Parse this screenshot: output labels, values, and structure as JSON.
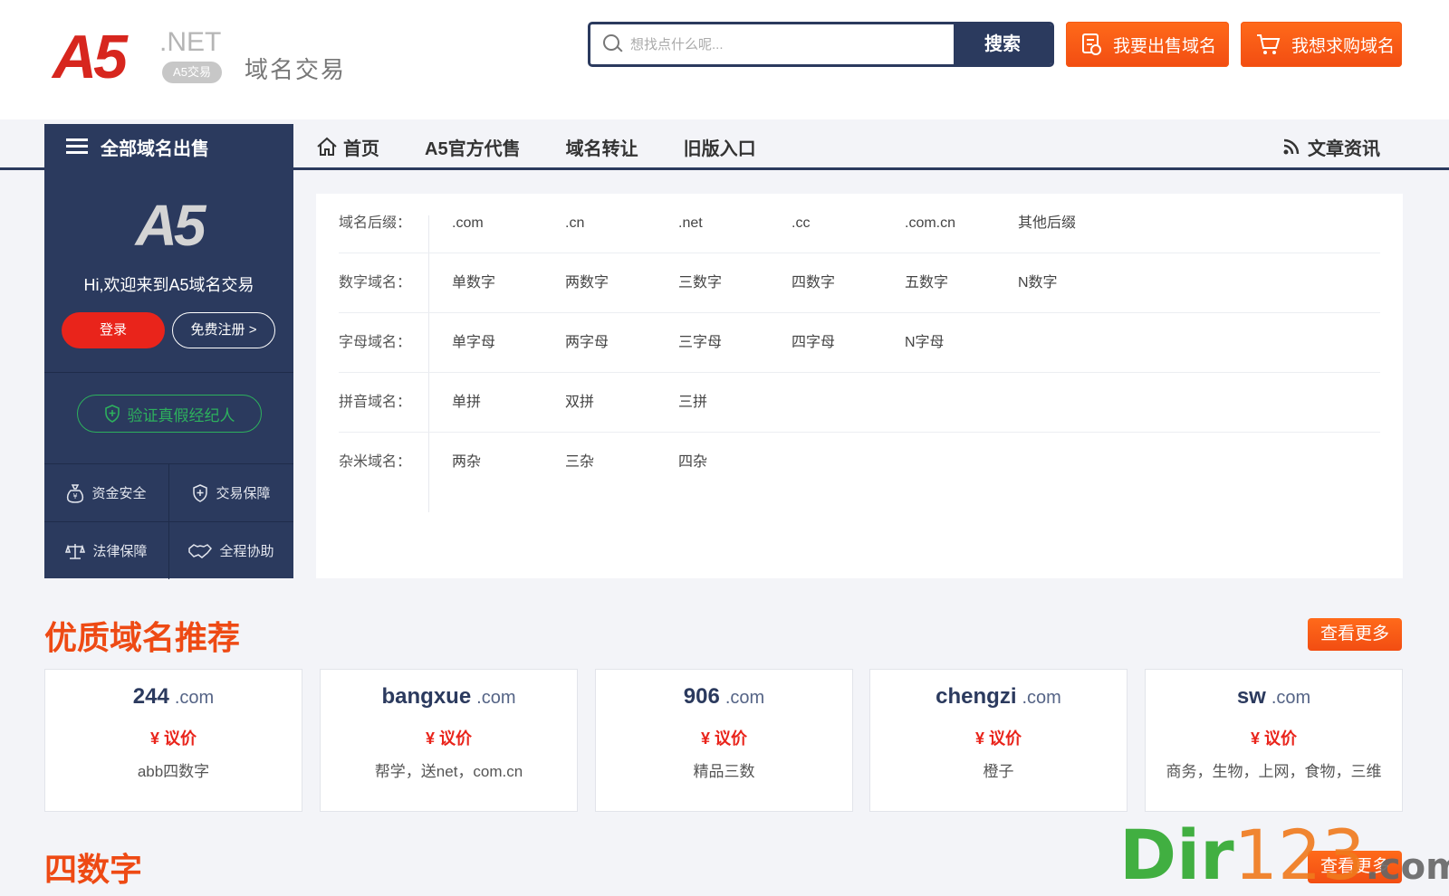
{
  "header": {
    "logo_main": "A5",
    "logo_net": ".NET",
    "logo_badge": "A5交易",
    "logo_subtitle": "域名交易",
    "search_placeholder": "想找点什么呢...",
    "search_button": "搜索",
    "sell_button": "我要出售域名",
    "buy_button": "我想求购域名",
    "accent_color": "#f55a16",
    "navy_color": "#2b3a5e"
  },
  "nav": {
    "category_label": "全部域名出售",
    "items": [
      {
        "label": "首页",
        "icon": "home-icon"
      },
      {
        "label": "A5官方代售"
      },
      {
        "label": "域名转让"
      },
      {
        "label": "旧版入口"
      }
    ],
    "articles_label": "文章资讯",
    "articles_icon": "rss-icon"
  },
  "sidebar": {
    "logo": "A5",
    "welcome": "Hi,欢迎来到A5域名交易",
    "login": "登录",
    "register": "免费注册 >",
    "verify": "验证真假经纪人",
    "features": [
      {
        "label": "资金安全",
        "icon": "money-bag-icon"
      },
      {
        "label": "交易保障",
        "icon": "shield-plus-icon"
      },
      {
        "label": "法律保障",
        "icon": "scale-icon"
      },
      {
        "label": "全程协助",
        "icon": "handshake-icon"
      }
    ]
  },
  "categories": [
    {
      "label": "域名后缀：",
      "links": [
        ".com",
        ".cn",
        ".net",
        ".cc",
        ".com.cn",
        "其他后缀"
      ]
    },
    {
      "label": "数字域名：",
      "links": [
        "单数字",
        "两数字",
        "三数字",
        "四数字",
        "五数字",
        "N数字"
      ]
    },
    {
      "label": "字母域名：",
      "links": [
        "单字母",
        "两字母",
        "三字母",
        "四字母",
        "N字母"
      ]
    },
    {
      "label": "拼音域名：",
      "links": [
        "单拼",
        "双拼",
        "三拼"
      ]
    },
    {
      "label": "杂米域名：",
      "links": [
        "两杂",
        "三杂",
        "四杂"
      ]
    }
  ],
  "featured": {
    "title": "优质域名推荐",
    "more": "查看更多",
    "cards": [
      {
        "name": "244",
        "tld": ".com",
        "price": "¥ 议价",
        "desc": "abb四数字"
      },
      {
        "name": "bangxue",
        "tld": ".com",
        "price": "¥ 议价",
        "desc": "帮学，送net，com.cn"
      },
      {
        "name": "906",
        "tld": ".com",
        "price": "¥ 议价",
        "desc": "精品三数"
      },
      {
        "name": "chengzi",
        "tld": ".com",
        "price": "¥ 议价",
        "desc": "橙子"
      },
      {
        "name": "sw",
        "tld": ".com",
        "price": "¥ 议价",
        "desc": "商务，生物，上网，食物，三维"
      }
    ]
  },
  "four_digit": {
    "title": "四数字",
    "more": "查看更多"
  },
  "watermark": {
    "part1": "Dir",
    "part2": "123",
    "part3": ".com"
  }
}
